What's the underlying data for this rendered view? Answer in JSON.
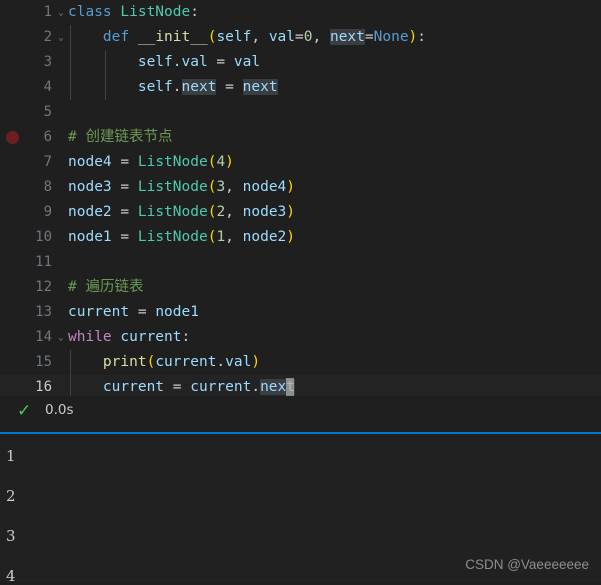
{
  "editor": {
    "language": "python",
    "active_line": 16,
    "breakpoint_line": 6,
    "cursor": {
      "line": 16,
      "after_text": "current = current.next"
    },
    "highlighted_word": "next",
    "lines": [
      {
        "num": "1",
        "fold": "chevron-down",
        "tokens": [
          {
            "t": "class",
            "c": "k-class"
          },
          {
            "t": " ",
            "c": "t-punc"
          },
          {
            "t": "ListNode",
            "c": "t-type"
          },
          {
            "t": ":",
            "c": "t-punc"
          }
        ]
      },
      {
        "num": "2",
        "fold": "chevron-down",
        "tokens": [
          {
            "t": "    ",
            "c": "t-punc"
          },
          {
            "t": "def",
            "c": "k-class"
          },
          {
            "t": " ",
            "c": "t-punc"
          },
          {
            "t": "__init__",
            "c": "t-func"
          },
          {
            "t": "(",
            "c": "t-paren"
          },
          {
            "t": "self",
            "c": "t-self"
          },
          {
            "t": ", ",
            "c": "t-punc"
          },
          {
            "t": "val",
            "c": "t-var"
          },
          {
            "t": "=",
            "c": "t-punc"
          },
          {
            "t": "0",
            "c": "t-num"
          },
          {
            "t": ", ",
            "c": "t-punc"
          },
          {
            "t": "next",
            "c": "t-var hl-word"
          },
          {
            "t": "=",
            "c": "t-punc"
          },
          {
            "t": "None",
            "c": "t-const"
          },
          {
            "t": ")",
            "c": "t-paren"
          },
          {
            "t": ":",
            "c": "t-punc"
          }
        ]
      },
      {
        "num": "3",
        "fold": "",
        "tokens": [
          {
            "t": "        ",
            "c": "t-punc"
          },
          {
            "t": "self",
            "c": "t-self"
          },
          {
            "t": ".",
            "c": "t-punc"
          },
          {
            "t": "val",
            "c": "t-var"
          },
          {
            "t": " = ",
            "c": "t-punc"
          },
          {
            "t": "val",
            "c": "t-var"
          }
        ]
      },
      {
        "num": "4",
        "fold": "",
        "tokens": [
          {
            "t": "        ",
            "c": "t-punc"
          },
          {
            "t": "self",
            "c": "t-self"
          },
          {
            "t": ".",
            "c": "t-punc"
          },
          {
            "t": "next",
            "c": "t-var hl-word"
          },
          {
            "t": " = ",
            "c": "t-punc"
          },
          {
            "t": "next",
            "c": "t-var hl-word"
          }
        ]
      },
      {
        "num": "5",
        "fold": "",
        "tokens": []
      },
      {
        "num": "6",
        "fold": "",
        "tokens": [
          {
            "t": "# 创建链表节点",
            "c": "t-comment"
          }
        ]
      },
      {
        "num": "7",
        "fold": "",
        "tokens": [
          {
            "t": "node4",
            "c": "t-var"
          },
          {
            "t": " = ",
            "c": "t-punc"
          },
          {
            "t": "ListNode",
            "c": "t-type"
          },
          {
            "t": "(",
            "c": "t-paren"
          },
          {
            "t": "4",
            "c": "t-num"
          },
          {
            "t": ")",
            "c": "t-paren"
          }
        ]
      },
      {
        "num": "8",
        "fold": "",
        "tokens": [
          {
            "t": "node3",
            "c": "t-var"
          },
          {
            "t": " = ",
            "c": "t-punc"
          },
          {
            "t": "ListNode",
            "c": "t-type"
          },
          {
            "t": "(",
            "c": "t-paren"
          },
          {
            "t": "3",
            "c": "t-num"
          },
          {
            "t": ", ",
            "c": "t-punc"
          },
          {
            "t": "node4",
            "c": "t-var"
          },
          {
            "t": ")",
            "c": "t-paren"
          }
        ]
      },
      {
        "num": "9",
        "fold": "",
        "tokens": [
          {
            "t": "node2",
            "c": "t-var"
          },
          {
            "t": " = ",
            "c": "t-punc"
          },
          {
            "t": "ListNode",
            "c": "t-type"
          },
          {
            "t": "(",
            "c": "t-paren"
          },
          {
            "t": "2",
            "c": "t-num"
          },
          {
            "t": ", ",
            "c": "t-punc"
          },
          {
            "t": "node3",
            "c": "t-var"
          },
          {
            "t": ")",
            "c": "t-paren"
          }
        ]
      },
      {
        "num": "10",
        "fold": "",
        "tokens": [
          {
            "t": "node1",
            "c": "t-var"
          },
          {
            "t": " = ",
            "c": "t-punc"
          },
          {
            "t": "ListNode",
            "c": "t-type"
          },
          {
            "t": "(",
            "c": "t-paren"
          },
          {
            "t": "1",
            "c": "t-num"
          },
          {
            "t": ", ",
            "c": "t-punc"
          },
          {
            "t": "node2",
            "c": "t-var"
          },
          {
            "t": ")",
            "c": "t-paren"
          }
        ]
      },
      {
        "num": "11",
        "fold": "",
        "tokens": []
      },
      {
        "num": "12",
        "fold": "",
        "tokens": [
          {
            "t": "# 遍历链表",
            "c": "t-comment"
          }
        ]
      },
      {
        "num": "13",
        "fold": "",
        "tokens": [
          {
            "t": "current",
            "c": "t-var"
          },
          {
            "t": " = ",
            "c": "t-punc"
          },
          {
            "t": "node1",
            "c": "t-var"
          }
        ]
      },
      {
        "num": "14",
        "fold": "chevron-down",
        "tokens": [
          {
            "t": "while",
            "c": "k-ctrl"
          },
          {
            "t": " ",
            "c": "t-punc"
          },
          {
            "t": "current",
            "c": "t-var"
          },
          {
            "t": ":",
            "c": "t-punc"
          }
        ]
      },
      {
        "num": "15",
        "fold": "",
        "tokens": [
          {
            "t": "    ",
            "c": "t-punc"
          },
          {
            "t": "print",
            "c": "t-func"
          },
          {
            "t": "(",
            "c": "t-paren"
          },
          {
            "t": "current",
            "c": "t-var"
          },
          {
            "t": ".",
            "c": "t-punc"
          },
          {
            "t": "val",
            "c": "t-var"
          },
          {
            "t": ")",
            "c": "t-paren"
          }
        ]
      },
      {
        "num": "16",
        "fold": "",
        "tokens": [
          {
            "t": "    ",
            "c": "t-punc"
          },
          {
            "t": "current",
            "c": "t-var"
          },
          {
            "t": " = ",
            "c": "t-punc"
          },
          {
            "t": "current",
            "c": "t-var"
          },
          {
            "t": ".",
            "c": "t-punc"
          },
          {
            "t": "next",
            "c": "t-var hl-word"
          }
        ]
      }
    ]
  },
  "status": {
    "icon": "check-icon",
    "success_color": "#4ec94e",
    "elapsed": "0.0s"
  },
  "output": {
    "lines": [
      "1",
      "2",
      "3",
      "4"
    ]
  },
  "watermark": {
    "text": "CSDN @Vaeeeeeee"
  },
  "colors": {
    "editor_background": "#1f1f1f",
    "output_background": "#212121",
    "accent_rule": "#0078d4",
    "breakpoint": "#6e1e1e",
    "word_highlight": "#3a3d41",
    "cursor": "#aeafad"
  }
}
